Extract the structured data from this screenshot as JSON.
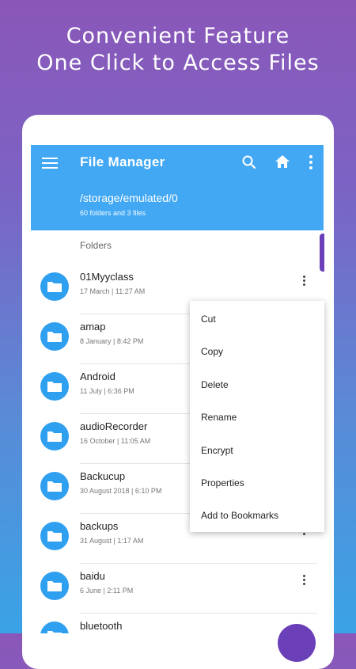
{
  "promo": {
    "line1": "Convenient Feature",
    "line2": "One Click to Access Files"
  },
  "appbar": {
    "title": "File Manager",
    "path": "/storage/emulated/0",
    "counts": "60 folders and 3 files",
    "icons": [
      "menu-icon",
      "search-icon",
      "home-icon",
      "more-vert-icon"
    ],
    "color": "#42a8f4"
  },
  "section_title": "Folders",
  "folders": [
    {
      "name": "01Myyclass",
      "date": "17 March | 11:27 AM"
    },
    {
      "name": "amap",
      "date": "8 January | 8:42 PM"
    },
    {
      "name": "Android",
      "date": "11 July | 6:36 PM"
    },
    {
      "name": "audioRecorder",
      "date": "16 October | 11:05 AM"
    },
    {
      "name": "Backucup",
      "date": "30 August 2018 | 6:10 PM"
    },
    {
      "name": "backups",
      "date": "31 August | 1:17 AM"
    },
    {
      "name": "baidu",
      "date": "6 June | 2:11 PM"
    },
    {
      "name": "bluetooth",
      "date": ""
    }
  ],
  "context_menu": {
    "items": [
      "Cut",
      "Copy",
      "Delete",
      "Rename",
      "Encrypt",
      "Properties",
      "Add to Bookmarks"
    ]
  },
  "colors": {
    "folder_circle": "#2f9ff0",
    "fab": "#6a3fb8"
  }
}
